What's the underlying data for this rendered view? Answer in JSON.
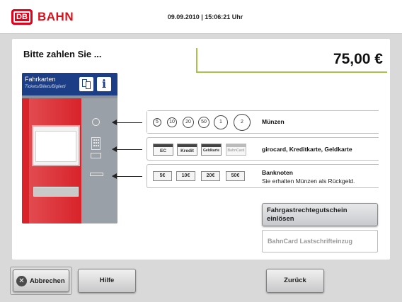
{
  "header": {
    "brand_logo": "DB",
    "brand_name": "BAHN",
    "datetime": "09.09.2010 | 15:06:21 Uhr"
  },
  "main": {
    "title": "Bitte zahlen Sie ...",
    "amount": "75,00 €"
  },
  "machine": {
    "title": "Fahrkarten",
    "subtitle": "Tickets/Billets/Biglietti",
    "info_glyph": "i"
  },
  "payment": {
    "coins": {
      "values": [
        "5",
        "10",
        "20",
        "50",
        "1",
        "2"
      ],
      "label": "Münzen"
    },
    "cards": {
      "values": [
        "EC",
        "Kredit",
        "Geldkarte",
        "BahnCard"
      ],
      "label": "girocard, Kreditkarte, Geldkarte"
    },
    "notes": {
      "values": [
        "5€",
        "10€",
        "20€",
        "50€"
      ],
      "label": "Banknoten",
      "sub": "Sie erhalten Münzen als Rückgeld."
    }
  },
  "actions": {
    "voucher_label": "Fahrgastrechtegutschein einlösen",
    "bahncard_label": "BahnCard Lastschrifteinzug"
  },
  "footer": {
    "cancel_label": "Abbrechen",
    "help_label": "Hilfe",
    "back_label": "Zurück"
  },
  "colors": {
    "brand_red": "#e2001a",
    "accent_green": "#a9c34a",
    "machine_blue": "#1c3e86"
  }
}
